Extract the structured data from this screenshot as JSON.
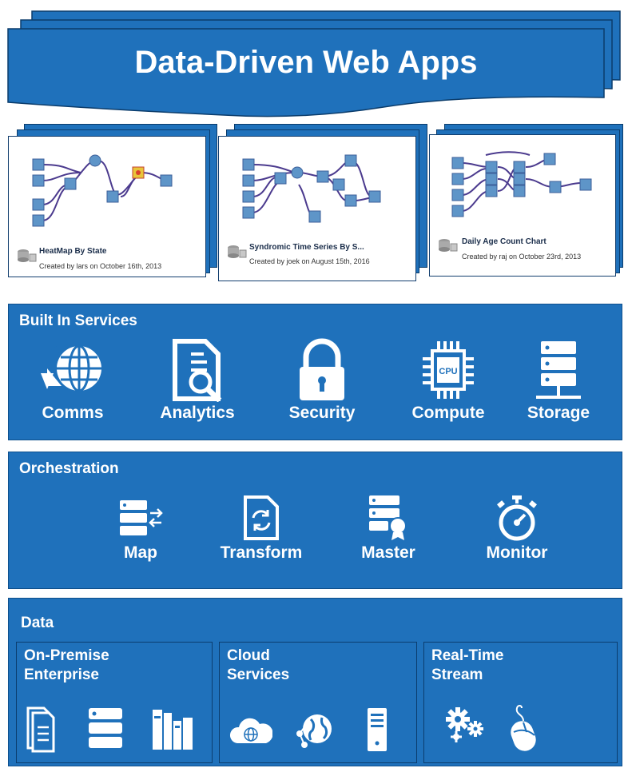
{
  "banner": {
    "title": "Data-Driven Web Apps"
  },
  "apps": [
    {
      "title": "HeatMap By State",
      "created": "Created by lars on October 16th, 2013"
    },
    {
      "title": "Syndromic Time Series By S...",
      "created": "Created by joek on August 15th, 2016"
    },
    {
      "title": "Daily Age Count Chart",
      "created": "Created by raj on October 23rd, 2013"
    }
  ],
  "built_in": {
    "title": "Built In Services",
    "items": [
      {
        "label": "Comms",
        "icon": "globe-sync-icon"
      },
      {
        "label": "Analytics",
        "icon": "document-search-icon"
      },
      {
        "label": "Security",
        "icon": "padlock-icon"
      },
      {
        "label": "Compute",
        "icon": "cpu-chip-icon",
        "chip_text": "CPU"
      },
      {
        "label": "Storage",
        "icon": "server-stack-icon"
      }
    ]
  },
  "orchestration": {
    "title": "Orchestration",
    "items": [
      {
        "label": "Map",
        "icon": "server-arrows-icon"
      },
      {
        "label": "Transform",
        "icon": "document-refresh-icon"
      },
      {
        "label": "Master",
        "icon": "server-award-icon"
      },
      {
        "label": "Monitor",
        "icon": "stopwatch-icon"
      }
    ]
  },
  "data": {
    "title": "Data",
    "groups": [
      {
        "title": "On-Premise\nEnterprise",
        "line1": "On-Premise",
        "line2": "Enterprise",
        "icons": [
          "documents-icon",
          "server-icon",
          "archive-icon"
        ]
      },
      {
        "title": "Cloud\nServices",
        "line1": "Cloud",
        "line2": "Services",
        "icons": [
          "cloud-globe-icon",
          "globe-network-icon",
          "tower-server-icon"
        ]
      },
      {
        "title": "Real-Time\nStream",
        "line1": "Real-Time",
        "line2": "Stream",
        "icons": [
          "gears-icon",
          "mouse-icon"
        ]
      }
    ]
  },
  "colors": {
    "panel": "#1f71bb",
    "dark": "#0b3c6b",
    "node": "#5e95c8",
    "wire": "#4b3a8e"
  }
}
